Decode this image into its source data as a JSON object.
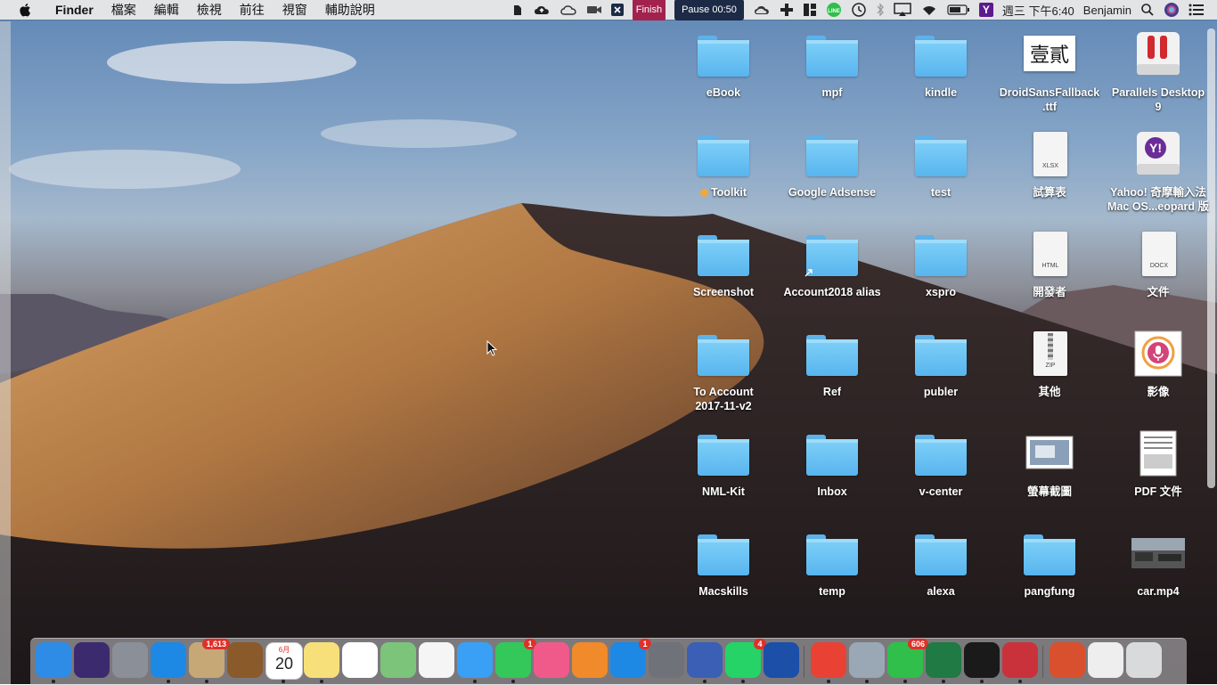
{
  "menubar": {
    "app_name": "Finder",
    "items": [
      "檔案",
      "編輯",
      "檢視",
      "前往",
      "視窗",
      "輔助說明"
    ],
    "status": {
      "finish_label": "Finish",
      "pause_label": "Pause 00:50",
      "line_label": "LINE",
      "yahoo_label": "Y",
      "clock": "週三 下午6:40",
      "user": "Benjamin"
    }
  },
  "desktop_items": [
    {
      "label": "eBook",
      "kind": "folder",
      "icon": "folder-icon"
    },
    {
      "label": "mpf",
      "kind": "folder",
      "icon": "folder-icon"
    },
    {
      "label": "kindle",
      "kind": "folder",
      "icon": "folder-icon"
    },
    {
      "label": "DroidSansFallback\n.ttf",
      "kind": "font",
      "icon": "font-file-icon",
      "glyph": "壹貳"
    },
    {
      "label": "Parallels Desktop\n9",
      "kind": "app",
      "icon": "parallels-icon"
    },
    {
      "label": "Toolkit",
      "kind": "folder",
      "icon": "folder-icon",
      "tag_color": "#f0a83a"
    },
    {
      "label": "Google Adsense",
      "kind": "folder",
      "icon": "folder-icon"
    },
    {
      "label": "test",
      "kind": "folder",
      "icon": "folder-icon"
    },
    {
      "label": "試算表",
      "kind": "smart",
      "icon": "spreadsheet-icon",
      "ext": "XLSX"
    },
    {
      "label": "Yahoo! 奇摩輸入法\nMac OS...eopard 版",
      "kind": "app",
      "icon": "yahoo-disk-icon"
    },
    {
      "label": "Screenshot",
      "kind": "folder",
      "icon": "folder-icon"
    },
    {
      "label": "Account2018 alias",
      "kind": "alias",
      "icon": "folder-alias-icon"
    },
    {
      "label": "xspro",
      "kind": "folder",
      "icon": "folder-icon"
    },
    {
      "label": "開發者",
      "kind": "doc",
      "icon": "html-file-icon",
      "ext": "HTML"
    },
    {
      "label": "文件",
      "kind": "doc",
      "icon": "docx-file-icon",
      "ext": "DOCX"
    },
    {
      "label": "To Account\n2017-11-v2",
      "kind": "folder",
      "icon": "folder-icon"
    },
    {
      "label": "Ref",
      "kind": "folder",
      "icon": "folder-icon"
    },
    {
      "label": "publer",
      "kind": "folder",
      "icon": "folder-icon"
    },
    {
      "label": "其他",
      "kind": "doc",
      "icon": "zip-file-icon",
      "ext": "ZIP"
    },
    {
      "label": "影像",
      "kind": "stack",
      "icon": "image-stack-icon"
    },
    {
      "label": "NML-Kit",
      "kind": "folder",
      "icon": "folder-icon"
    },
    {
      "label": "Inbox",
      "kind": "folder",
      "icon": "folder-icon"
    },
    {
      "label": "v-center",
      "kind": "folder",
      "icon": "folder-icon"
    },
    {
      "label": "螢幕截圖",
      "kind": "stack",
      "icon": "screenshot-stack-icon"
    },
    {
      "label": "PDF 文件",
      "kind": "stack",
      "icon": "pdf-stack-icon"
    },
    {
      "label": "Macskills",
      "kind": "folder",
      "icon": "folder-icon"
    },
    {
      "label": "temp",
      "kind": "folder",
      "icon": "folder-icon"
    },
    {
      "label": "alexa",
      "kind": "folder",
      "icon": "folder-icon"
    },
    {
      "label": "pangfung",
      "kind": "folder",
      "icon": "folder-icon"
    },
    {
      "label": "car.mp4",
      "kind": "video",
      "icon": "video-thumbnail-icon"
    }
  ],
  "dock": {
    "apps": [
      {
        "name": "finder-icon",
        "color": "#2f8ce6",
        "running": true
      },
      {
        "name": "siri-icon",
        "color": "#3c2a6e",
        "running": false
      },
      {
        "name": "launchpad-icon",
        "color": "#8a8f98",
        "running": false
      },
      {
        "name": "safari-icon",
        "color": "#1e88e5",
        "running": true
      },
      {
        "name": "mail-icon",
        "color": "#c6a877",
        "running": true,
        "badge": "1,613"
      },
      {
        "name": "contacts-icon",
        "color": "#8b5a2b",
        "running": false
      },
      {
        "name": "calendar-icon",
        "color": "#ffffff",
        "running": true,
        "month": "6月",
        "day": "20"
      },
      {
        "name": "notes-icon",
        "color": "#f7e07a",
        "running": true
      },
      {
        "name": "reminders-icon",
        "color": "#ffffff",
        "running": false
      },
      {
        "name": "maps-icon",
        "color": "#7cc47a",
        "running": false
      },
      {
        "name": "photos-icon",
        "color": "#f5f5f5",
        "running": false
      },
      {
        "name": "messages-icon",
        "color": "#3aa0f5",
        "running": true
      },
      {
        "name": "facetime-icon",
        "color": "#34c759",
        "running": true,
        "badge": "1"
      },
      {
        "name": "itunes-icon",
        "color": "#f05a8a",
        "running": false
      },
      {
        "name": "ibooks-icon",
        "color": "#f08a2a",
        "running": false
      },
      {
        "name": "app-store-icon",
        "color": "#1e88e5",
        "running": false,
        "badge": "1"
      },
      {
        "name": "system-preferences-icon",
        "color": "#6f7278",
        "running": false
      },
      {
        "name": "omnifocus-icon",
        "color": "#3a5fb5",
        "running": true
      },
      {
        "name": "whatsapp-icon",
        "color": "#25d366",
        "running": true,
        "badge": "4"
      },
      {
        "name": "airdrop-icon",
        "color": "#1b4fa8",
        "running": false
      },
      {
        "name": "chrome-icon",
        "color": "#e94235",
        "running": true
      },
      {
        "name": "preview-icon",
        "color": "#9aa7b5",
        "running": true
      },
      {
        "name": "line-icon",
        "color": "#2fbf4a",
        "running": true,
        "badge": "606"
      },
      {
        "name": "excel-icon",
        "color": "#1f7a43",
        "running": true
      },
      {
        "name": "terminal-icon",
        "color": "#1a1a1a",
        "running": true
      },
      {
        "name": "parallels-icon",
        "color": "#c9323a",
        "running": true
      },
      {
        "name": "books-stack-icon",
        "color": "#d9502f",
        "running": false
      },
      {
        "name": "documents-stack-icon",
        "color": "#eeeeee",
        "running": false
      },
      {
        "name": "trash-icon",
        "color": "#d8dadc",
        "running": false
      }
    ]
  }
}
